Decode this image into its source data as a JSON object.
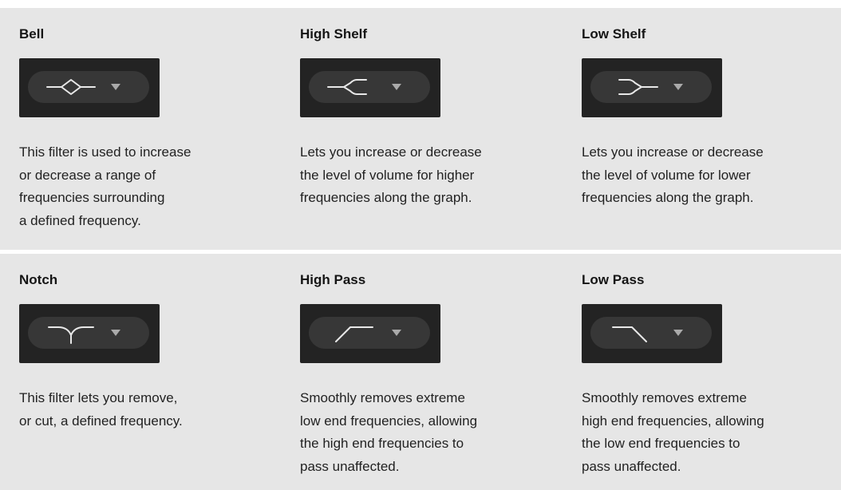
{
  "filters": [
    {
      "title": "Bell",
      "icon": "bell-curve-icon",
      "description_lines": [
        "This filter is used to increase",
        "or decrease a range of",
        "frequencies surrounding",
        "a defined frequency."
      ]
    },
    {
      "title": "High Shelf",
      "icon": "high-shelf-curve-icon",
      "description_lines": [
        "Lets you increase or decrease",
        "the level of volume for higher",
        "frequencies along the graph."
      ]
    },
    {
      "title": "Low Shelf",
      "icon": "low-shelf-curve-icon",
      "description_lines": [
        "Lets you increase or decrease",
        "the level of volume for lower",
        "frequencies along the graph."
      ]
    },
    {
      "title": "Notch",
      "icon": "notch-curve-icon",
      "description_lines": [
        "This filter lets you remove,",
        "or cut, a defined frequency."
      ]
    },
    {
      "title": "High Pass",
      "icon": "high-pass-curve-icon",
      "description_lines": [
        "Smoothly removes extreme",
        "low end frequencies, allowing",
        "the high end frequencies to",
        "pass unaffected."
      ]
    },
    {
      "title": "Low Pass",
      "icon": "low-pass-curve-icon",
      "description_lines": [
        "Smoothly removes extreme",
        "high end frequencies, allowing",
        "the low end frequencies to",
        "pass unaffected."
      ]
    }
  ],
  "colors": {
    "cell_background": "#e6e6e6",
    "panel_background": "#232323",
    "pill_background": "#373737",
    "icon_stroke": "#e8e8e8",
    "arrow_fill": "#aaaaaa"
  },
  "dropdown_arrow_icon": "triangle-down-icon"
}
